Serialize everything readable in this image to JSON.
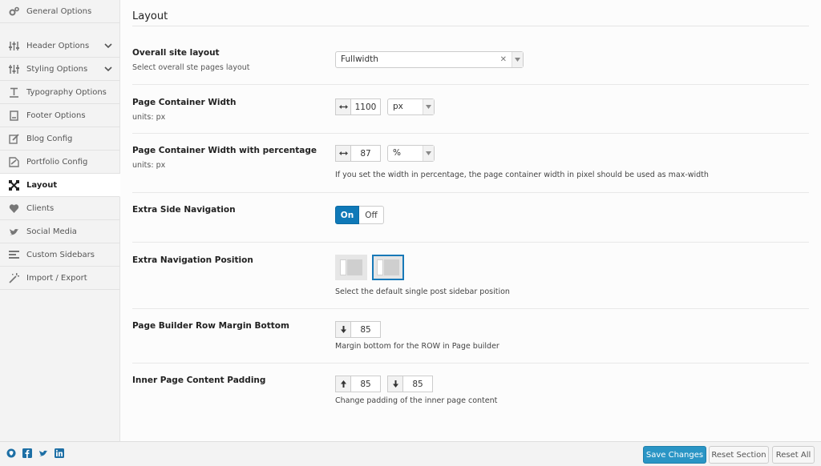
{
  "sidebar": {
    "items": [
      {
        "label": "General Options",
        "icon": "gears-icon"
      },
      {
        "label": "Header Options",
        "icon": "sliders-icon",
        "expandable": true
      },
      {
        "label": "Styling Options",
        "icon": "sliders-icon",
        "expandable": true
      },
      {
        "label": "Typography Options",
        "icon": "text-icon"
      },
      {
        "label": "Footer Options",
        "icon": "document-icon"
      },
      {
        "label": "Blog Config",
        "icon": "pencil-icon"
      },
      {
        "label": "Portfolio Config",
        "icon": "portfolio-icon"
      },
      {
        "label": "Layout",
        "icon": "arrows-expand-icon",
        "active": true
      },
      {
        "label": "Clients",
        "icon": "heart-icon"
      },
      {
        "label": "Social Media",
        "icon": "twitter-icon"
      },
      {
        "label": "Custom Sidebars",
        "icon": "list-icon"
      },
      {
        "label": "Import / Export",
        "icon": "magic-wand-icon"
      }
    ]
  },
  "main": {
    "title": "Layout",
    "overall_layout": {
      "label": "Overall site layout",
      "sub": "Select overall ste pages layout",
      "value": "Fullwidth"
    },
    "container_width": {
      "label": "Page Container Width",
      "sub": "units: px",
      "value": "1100",
      "unit": "px"
    },
    "container_width_pct": {
      "label": "Page Container Width with percentage",
      "sub": "units: px",
      "value": "87",
      "unit": "%",
      "desc": "If you set the width in percentage, the page container width in pixel should be used as max-width"
    },
    "extra_side_nav": {
      "label": "Extra Side Navigation",
      "on": "On",
      "off": "Off"
    },
    "extra_nav_position": {
      "label": "Extra Navigation Position",
      "desc": "Select the default single post sidebar position"
    },
    "row_margin": {
      "label": "Page Builder Row Margin Bottom",
      "value": "85",
      "desc": "Margin bottom for the ROW in Page builder"
    },
    "content_padding": {
      "label": "Inner Page Content Padding",
      "top": "85",
      "bottom": "85",
      "desc": "Change padding of the inner page content"
    }
  },
  "footer": {
    "save": "Save Changes",
    "reset_section": "Reset Section",
    "reset_all": "Reset All"
  },
  "colors": {
    "accent": "#0f79b8",
    "primary_button": "#2a95c5"
  }
}
